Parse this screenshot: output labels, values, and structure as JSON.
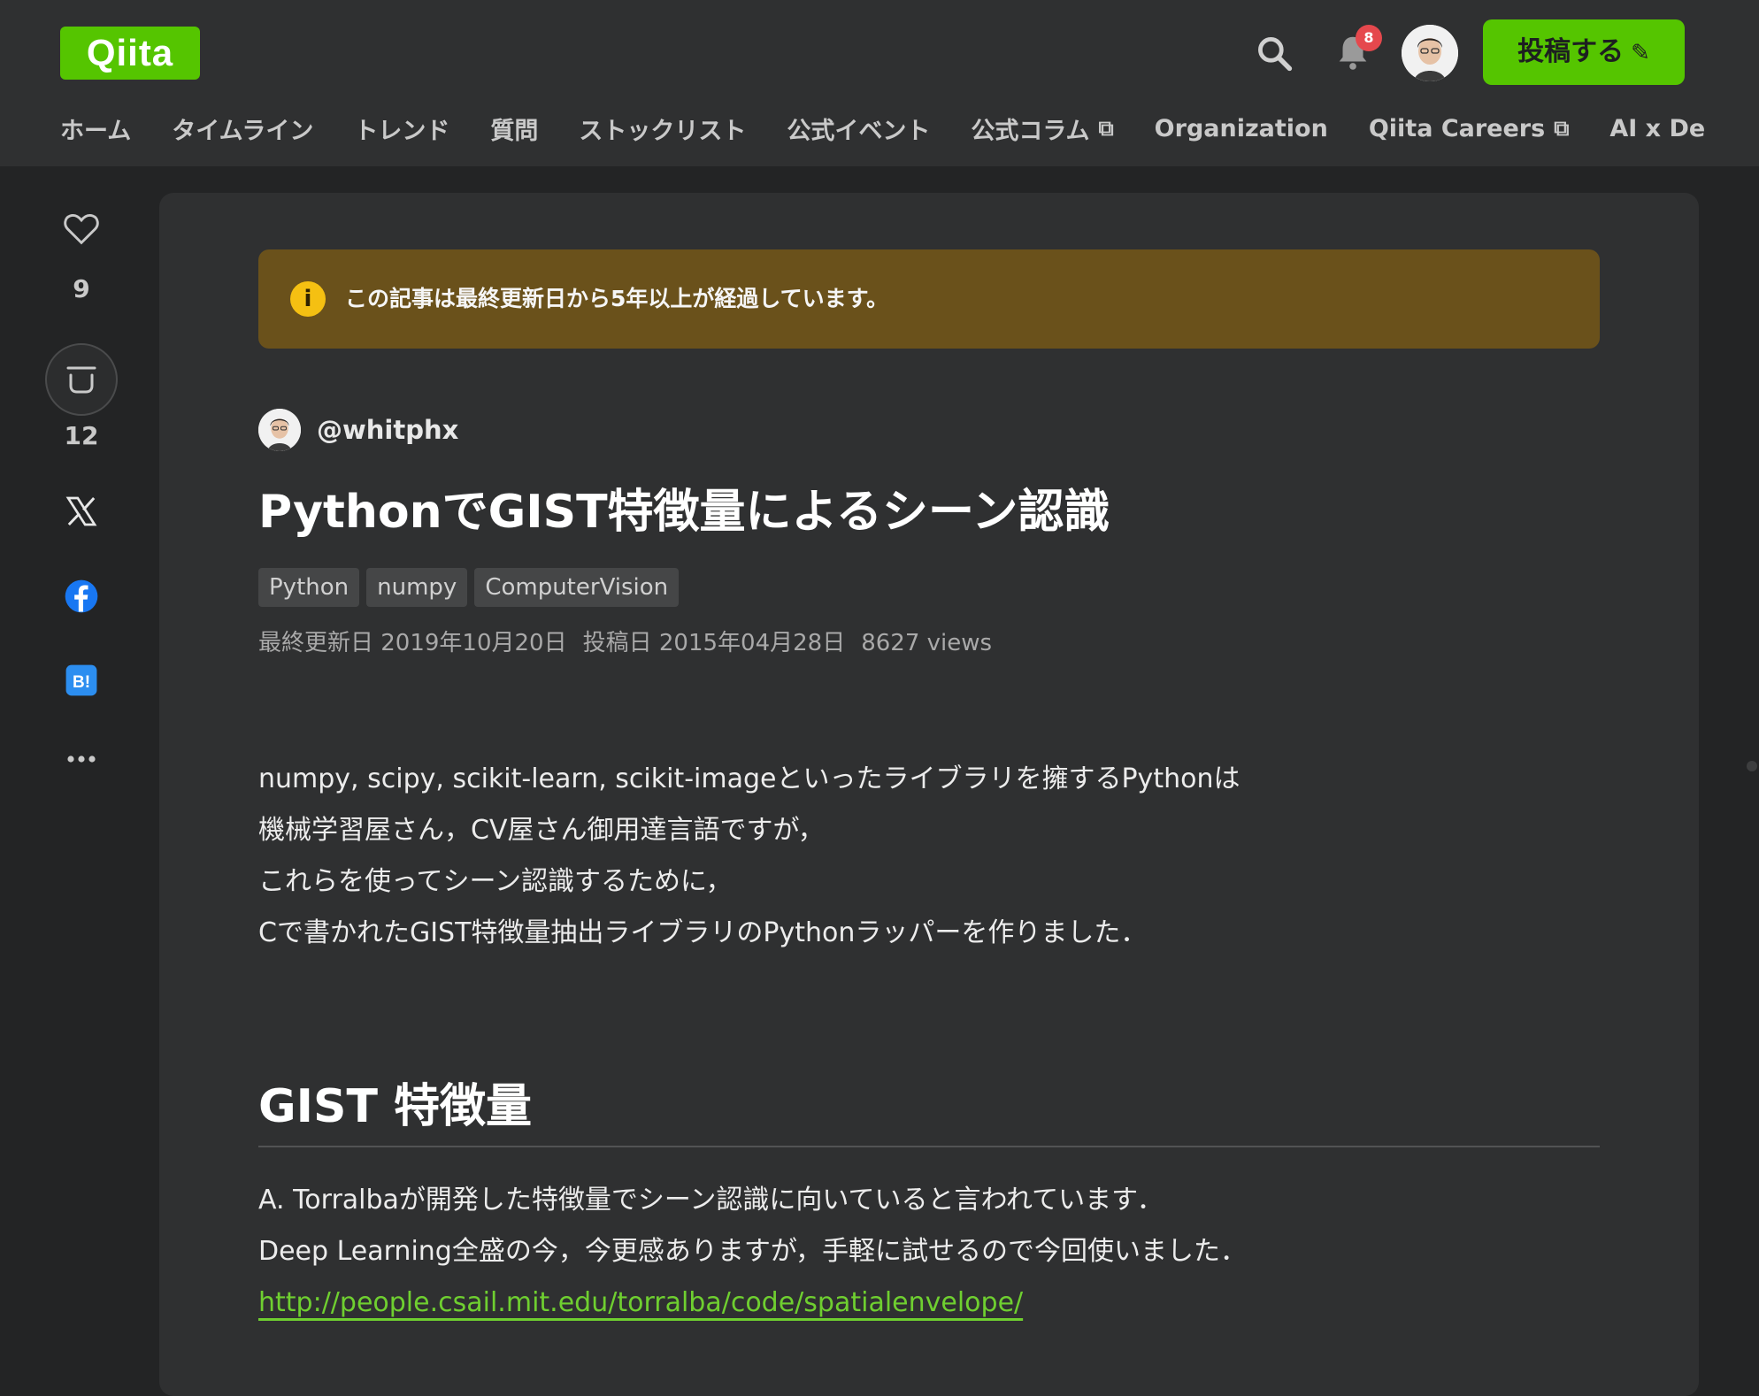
{
  "header": {
    "logo": "Qiita",
    "notification_count": "8",
    "post_button": "投稿する",
    "nav": [
      {
        "label": "ホーム",
        "external": false
      },
      {
        "label": "タイムライン",
        "external": false
      },
      {
        "label": "トレンド",
        "external": false
      },
      {
        "label": "質問",
        "external": false
      },
      {
        "label": "ストックリスト",
        "external": false
      },
      {
        "label": "公式イベント",
        "external": false
      },
      {
        "label": "公式コラム",
        "external": true
      },
      {
        "label": "Organization",
        "external": false
      },
      {
        "label": "Qiita Careers",
        "external": true
      },
      {
        "label": "AI x De",
        "external": false
      }
    ]
  },
  "side": {
    "like_count": "9",
    "stock_count": "12"
  },
  "article": {
    "notice": "この記事は最終更新日から5年以上が経過しています。",
    "author": "@whitphx",
    "title": "PythonでGIST特徴量によるシーン認識",
    "tags": [
      "Python",
      "numpy",
      "ComputerVision"
    ],
    "meta": {
      "updated": "最終更新日 2019年10月20日",
      "posted": "投稿日 2015年04月28日",
      "views": "8627 views"
    },
    "intro_lines": [
      "numpy, scipy, scikit-learn, scikit-imageといったライブラリを擁するPythonは",
      "機械学習屋さん，CV屋さん御用達言語ですが，",
      "これらを使ってシーン認識するために，",
      "Cで書かれたGIST特徴量抽出ライブラリのPythonラッパーを作りました．"
    ],
    "section_heading": "GIST 特徴量",
    "section_lines": [
      "A. Torralbaが開発した特徴量でシーン認識に向いていると言われています．",
      "Deep Learning全盛の今，今更感ありますが，手軽に試せるので今回使いました．"
    ],
    "section_link": "http://people.csail.mit.edu/torralba/code/spatialenvelope/"
  },
  "colors": {
    "accent": "#55c500",
    "link": "#6fcf30",
    "notice_bg": "#6a511b",
    "badge": "#e5484d"
  }
}
